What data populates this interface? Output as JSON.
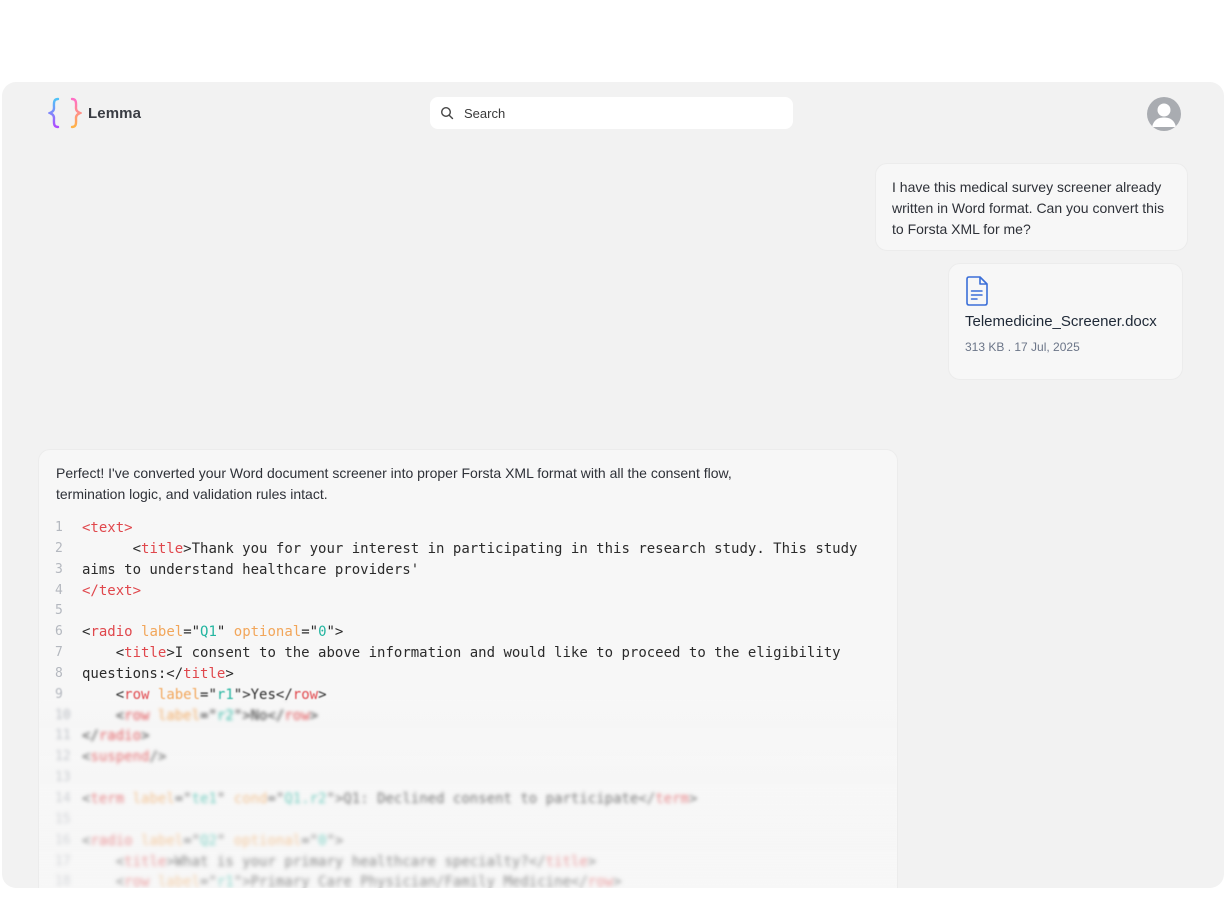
{
  "header": {
    "app_name": "Lemma",
    "search_placeholder": "Search"
  },
  "user_message": {
    "text": "I have this medical survey screener already written in Word format. Can you convert this to Forsta XML for me?"
  },
  "attachment": {
    "file_name": "Telemedicine_Screener.docx",
    "meta": "313 KB . 17 Jul, 2025",
    "icon": "document-icon"
  },
  "assistant_message": {
    "intro": "Perfect! I've converted your Word document screener into proper Forsta XML format with all the consent flow, termination logic, and validation rules intact.",
    "code_lines": [
      {
        "n": "1",
        "segs": [
          [
            "t",
            "<text>"
          ]
        ]
      },
      {
        "n": "2",
        "segs": [
          [
            "p",
            "      <"
          ],
          [
            "t",
            "title"
          ],
          [
            "p",
            ">Thank you for your interest in participating in this research study. This study"
          ]
        ]
      },
      {
        "n": "3",
        "segs": [
          [
            "p",
            "aims to understand healthcare providers'"
          ]
        ]
      },
      {
        "n": "4",
        "segs": [
          [
            "t",
            "</text>"
          ]
        ]
      },
      {
        "n": "5",
        "segs": []
      },
      {
        "n": "6",
        "segs": [
          [
            "p",
            "<"
          ],
          [
            "t",
            "radio"
          ],
          [
            "p",
            " "
          ],
          [
            "a",
            "label"
          ],
          [
            "p",
            "=\""
          ],
          [
            "v",
            "Q1"
          ],
          [
            "p",
            "\" "
          ],
          [
            "a",
            "optional"
          ],
          [
            "p",
            "=\""
          ],
          [
            "v",
            "0"
          ],
          [
            "p",
            "\">"
          ]
        ]
      },
      {
        "n": "7",
        "segs": [
          [
            "p",
            "    <"
          ],
          [
            "t",
            "title"
          ],
          [
            "p",
            ">I consent to the above information and would like to proceed to the eligibility"
          ]
        ]
      },
      {
        "n": "8",
        "segs": [
          [
            "p",
            "questions:</"
          ],
          [
            "t",
            "title"
          ],
          [
            "p",
            ">"
          ]
        ]
      },
      {
        "n": "9",
        "segs": [
          [
            "p",
            "    <"
          ],
          [
            "t",
            "row"
          ],
          [
            "p",
            " "
          ],
          [
            "a",
            "label"
          ],
          [
            "p",
            "=\""
          ],
          [
            "v",
            "r1"
          ],
          [
            "p",
            "\">Yes</"
          ],
          [
            "t",
            "row"
          ],
          [
            "p",
            ">"
          ]
        ]
      },
      {
        "n": "10",
        "segs": [
          [
            "p",
            "    <"
          ],
          [
            "t",
            "row"
          ],
          [
            "p",
            " "
          ],
          [
            "a",
            "label"
          ],
          [
            "p",
            "=\""
          ],
          [
            "v",
            "r2"
          ],
          [
            "p",
            "\">No</"
          ],
          [
            "t",
            "row"
          ],
          [
            "p",
            ">"
          ]
        ]
      },
      {
        "n": "11",
        "segs": [
          [
            "p",
            "</"
          ],
          [
            "t",
            "radio"
          ],
          [
            "p",
            ">"
          ]
        ]
      },
      {
        "n": "12",
        "segs": [
          [
            "p",
            "<"
          ],
          [
            "t",
            "suspend"
          ],
          [
            "p",
            "/>"
          ]
        ]
      },
      {
        "n": "13",
        "segs": []
      },
      {
        "n": "14",
        "segs": [
          [
            "p",
            "<"
          ],
          [
            "t",
            "term"
          ],
          [
            "p",
            " "
          ],
          [
            "a",
            "label"
          ],
          [
            "p",
            "=\""
          ],
          [
            "v",
            "te1"
          ],
          [
            "p",
            "\" "
          ],
          [
            "a",
            "cond"
          ],
          [
            "p",
            "=\""
          ],
          [
            "v",
            "Q1.r2"
          ],
          [
            "p",
            "\">Q1: Declined consent to participate</"
          ],
          [
            "t",
            "term"
          ],
          [
            "p",
            ">"
          ]
        ]
      },
      {
        "n": "15",
        "segs": []
      },
      {
        "n": "16",
        "segs": [
          [
            "p",
            "<"
          ],
          [
            "t",
            "radio"
          ],
          [
            "p",
            " "
          ],
          [
            "a",
            "label"
          ],
          [
            "p",
            "=\""
          ],
          [
            "v",
            "Q2"
          ],
          [
            "p",
            "\" "
          ],
          [
            "a",
            "optional"
          ],
          [
            "p",
            "=\""
          ],
          [
            "v",
            "0"
          ],
          [
            "p",
            "\">"
          ]
        ]
      },
      {
        "n": "17",
        "segs": [
          [
            "p",
            "    <"
          ],
          [
            "t",
            "title"
          ],
          [
            "p",
            ">What is your primary healthcare specialty?</"
          ],
          [
            "t",
            "title"
          ],
          [
            "p",
            ">"
          ]
        ]
      },
      {
        "n": "18",
        "segs": [
          [
            "p",
            "    <"
          ],
          [
            "t",
            "row"
          ],
          [
            "p",
            " "
          ],
          [
            "a",
            "label"
          ],
          [
            "p",
            "=\""
          ],
          [
            "v",
            "r1"
          ],
          [
            "p",
            "\">Primary Care Physician/Family Medicine</"
          ],
          [
            "t",
            "row"
          ],
          [
            "p",
            ">"
          ]
        ]
      }
    ]
  },
  "colors": {
    "tag": "#e0474c",
    "attribute": "#f2a65a",
    "value": "#23b5a0",
    "accent_blue": "#3b6fd8"
  }
}
